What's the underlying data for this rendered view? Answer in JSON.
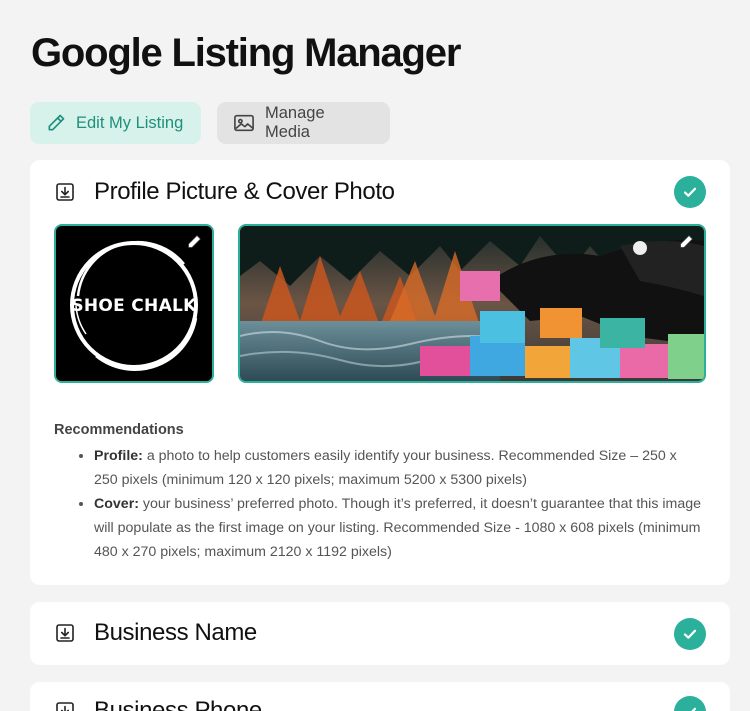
{
  "page": {
    "title": "Google Listing Manager"
  },
  "tabs": [
    {
      "label": "Edit My Listing",
      "icon": "pencil-icon",
      "active": true
    },
    {
      "label": "Manage Media",
      "icon": "image-icon",
      "active": false
    }
  ],
  "sections": [
    {
      "title": "Profile Picture & Cover Photo",
      "complete": true,
      "profile_logo_text": "SHOE CHALK",
      "recommendations": {
        "title": "Recommendations",
        "items": [
          {
            "label": "Profile:",
            "text": " a photo to help customers easily identify your business. Recommended Size – 250 x 250 pixels (minimum 120 x 120 pixels; maximum 5200 x 5300 pixels)"
          },
          {
            "label": "Cover:",
            "text": " your business’ preferred photo. Though it’s preferred, it doesn’t guarantee that this image will populate as the first image on your listing. Recommended Size - 1080 x 608 pixels (minimum 480 x 270 pixels; maximum 2120 x 1192 pixels)"
          }
        ]
      }
    },
    {
      "title": "Business Name",
      "complete": true
    },
    {
      "title": "Business Phone",
      "complete": true
    }
  ],
  "colors": {
    "accent": "#2bb09c",
    "accent_light": "#d7f2ea",
    "background": "#f3f3f3"
  }
}
